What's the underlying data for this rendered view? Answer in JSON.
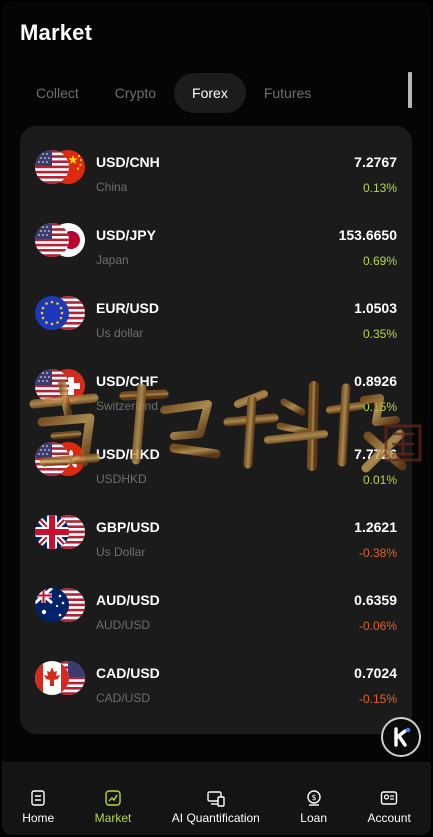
{
  "header": {
    "title": "Market"
  },
  "tabs": [
    {
      "label": "Collect",
      "active": false
    },
    {
      "label": "Crypto",
      "active": false
    },
    {
      "label": "Forex",
      "active": true
    },
    {
      "label": "Futures",
      "active": false
    }
  ],
  "markets": [
    {
      "pair": "USD/CNH",
      "sub": "China",
      "price": "7.2767",
      "change": "0.13%",
      "direction": "up",
      "flag": "us-cn-flag-icon"
    },
    {
      "pair": "USD/JPY",
      "sub": "Japan",
      "price": "153.6650",
      "change": "0.69%",
      "direction": "up",
      "flag": "us-jp-flag-icon"
    },
    {
      "pair": "EUR/USD",
      "sub": "Us dollar",
      "price": "1.0503",
      "change": "0.35%",
      "direction": "up",
      "flag": "eu-us-flag-icon"
    },
    {
      "pair": "USD/CHF",
      "sub": "Switzerland",
      "price": "0.8926",
      "change": "0.15%",
      "direction": "up",
      "flag": "us-ch-flag-icon"
    },
    {
      "pair": "USD/HKD",
      "sub": "USDHKD",
      "price": "7.7726",
      "change": "0.01%",
      "direction": "up",
      "flag": "us-hk-flag-icon"
    },
    {
      "pair": "GBP/USD",
      "sub": "Us Dollar",
      "price": "1.2621",
      "change": "-0.38%",
      "direction": "down",
      "flag": "gb-us-flag-icon"
    },
    {
      "pair": "AUD/USD",
      "sub": "AUD/USD",
      "price": "0.6359",
      "change": "-0.06%",
      "direction": "down",
      "flag": "au-us-flag-icon"
    },
    {
      "pair": "CAD/USD",
      "sub": "CAD/USD",
      "price": "0.7024",
      "change": "-0.15%",
      "direction": "down",
      "flag": "ca-us-flag-icon"
    }
  ],
  "colors": {
    "up": "#b6d93a",
    "down": "#e2612e",
    "card": "#1b1b1b",
    "active_nav": "#b6d93a"
  },
  "bottom_nav": [
    {
      "label": "Home",
      "icon": "home-icon",
      "active": false
    },
    {
      "label": "Market",
      "icon": "market-icon",
      "active": true
    },
    {
      "label": "AI Quantification",
      "icon": "ai-quantification-icon",
      "active": false
    },
    {
      "label": "Loan",
      "icon": "loan-icon",
      "active": false
    },
    {
      "label": "Account",
      "icon": "account-icon",
      "active": false
    }
  ]
}
